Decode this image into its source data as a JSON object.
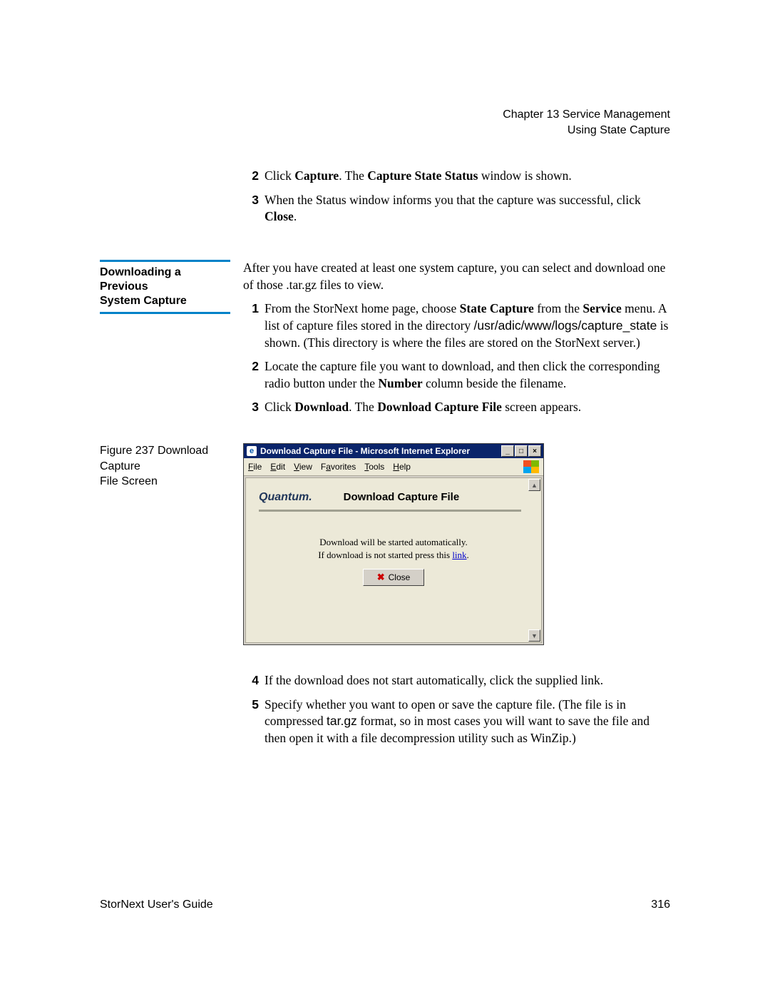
{
  "header": {
    "chapter": "Chapter 13  Service Management",
    "section": "Using State Capture"
  },
  "top_steps": [
    {
      "n": "2",
      "html": "Click <b>Capture</b>. The <b>Capture State Status</b> window is shown."
    },
    {
      "n": "3",
      "html": "When the Status window informs you that the capture was successful, click <b>Close</b>."
    }
  ],
  "section": {
    "title_line1": "Downloading a Previous",
    "title_line2": "System Capture",
    "intro": "After you have created at least one system capture, you can select and download one of those .tar.gz files to view.",
    "steps": [
      {
        "n": "1",
        "html": "From the StorNext home page, choose <b>State Capture</b> from the <b>Service</b> menu. A list of capture files stored in the directory <span class=\"sans\">/usr/adic/www/logs/capture_state</span> is shown. (This directory is where the files are stored on the StorNext server.)"
      },
      {
        "n": "2",
        "html": "Locate the capture file you want to download, and then click the corresponding radio button under the <b>Number</b> column beside the filename."
      },
      {
        "n": "3",
        "html": "Click <b>Download</b>. The <b>Download Capture File</b> screen appears."
      }
    ]
  },
  "figure": {
    "label_line1": "Figure 237  Download Capture",
    "label_line2": "File Screen"
  },
  "ie": {
    "title": "Download Capture File - Microsoft Internet Explorer",
    "menu": {
      "file": "File",
      "edit": "Edit",
      "view": "View",
      "favorites": "Favorites",
      "tools": "Tools",
      "help": "Help"
    },
    "brand": "Quantum.",
    "heading": "Download Capture File",
    "line1": "Download will be started automatically.",
    "line2_pre": "If download is not started press this ",
    "line2_link": "link",
    "line2_post": ".",
    "close": "Close"
  },
  "post_steps": [
    {
      "n": "4",
      "html": "If the download does not start automatically, click the supplied link."
    },
    {
      "n": "5",
      "html": "Specify whether you want to open or save the capture file. (The file is in compressed <span class=\"sans\">tar.gz</span> format, so in most cases you will want to save the file and then open it with a file decompression utility such as WinZip.)"
    }
  ],
  "footer": {
    "left": "StorNext User's Guide",
    "right": "316"
  }
}
